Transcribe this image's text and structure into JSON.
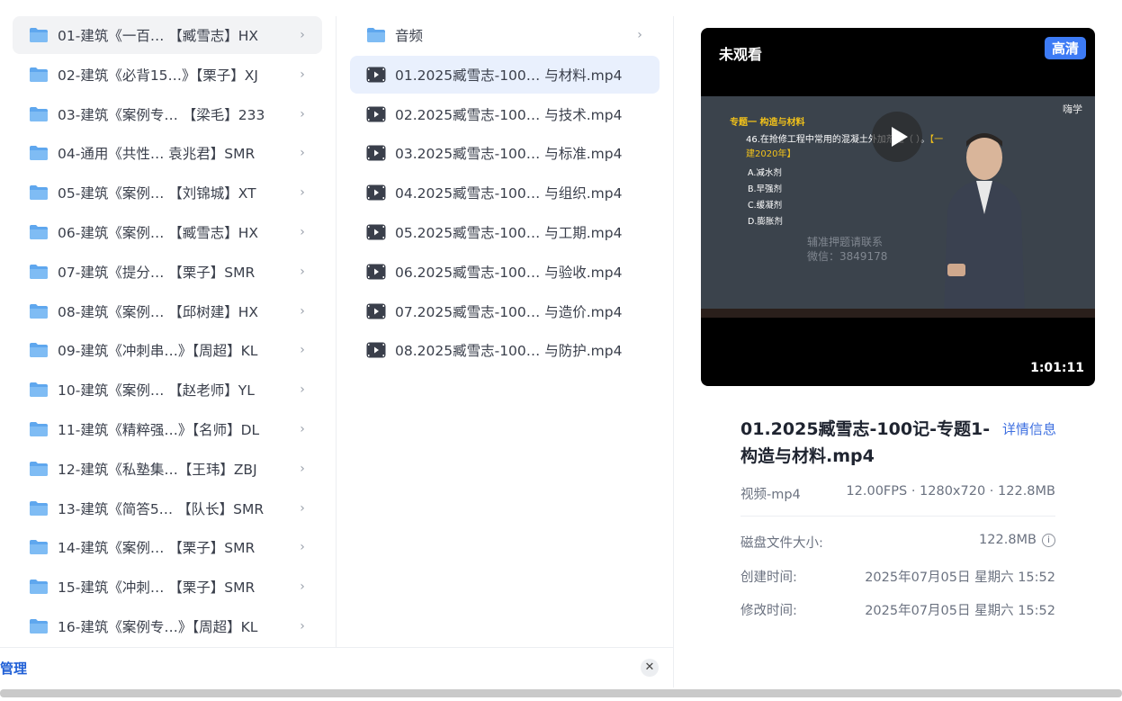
{
  "folders": [
    {
      "label": "01-建筑《一百…  【臧雪志】HX"
    },
    {
      "label": "02-建筑《必背15…》【栗子】XJ"
    },
    {
      "label": "03-建筑《案例专…  【梁毛】233"
    },
    {
      "label": "04-通用《共性…   袁兆君】SMR"
    },
    {
      "label": "05-建筑《案例…   【刘锦城】XT"
    },
    {
      "label": "06-建筑《案例…   【臧雪志】HX"
    },
    {
      "label": "07-建筑《提分…   【栗子】SMR"
    },
    {
      "label": "08-建筑《案例…   【邱树建】HX"
    },
    {
      "label": "09-建筑《冲刺串…》【周超】KL"
    },
    {
      "label": "10-建筑《案例…   【赵老师】YL"
    },
    {
      "label": "11-建筑《精粹强…》【名师】DL"
    },
    {
      "label": "12-建筑《私塾集…【王玮】ZBJ"
    },
    {
      "label": "13-建筑《简答5…  【队长】SMR"
    },
    {
      "label": "14-建筑《案例…   【栗子】SMR"
    },
    {
      "label": "15-建筑《冲刺…   【栗子】SMR"
    },
    {
      "label": "16-建筑《案例专…》【周超】KL"
    }
  ],
  "files": [
    {
      "label": "音频",
      "type": "folder"
    },
    {
      "label": "01.2025臧雪志-100…  与材料.mp4",
      "type": "video"
    },
    {
      "label": "02.2025臧雪志-100…  与技术.mp4",
      "type": "video"
    },
    {
      "label": "03.2025臧雪志-100…  与标准.mp4",
      "type": "video"
    },
    {
      "label": "04.2025臧雪志-100…  与组织.mp4",
      "type": "video"
    },
    {
      "label": "05.2025臧雪志-100…  与工期.mp4",
      "type": "video"
    },
    {
      "label": "06.2025臧雪志-100…  与验收.mp4",
      "type": "video"
    },
    {
      "label": "07.2025臧雪志-100…  与造价.mp4",
      "type": "video"
    },
    {
      "label": "08.2025臧雪志-100…  与防护.mp4",
      "type": "video"
    }
  ],
  "bottom": {
    "manage": "管理",
    "close_icon": "close-icon"
  },
  "preview": {
    "badge": "未观看",
    "quality": "高清",
    "duration": "1:01:11",
    "slide": {
      "title": "专题一 构造与材料",
      "logo": "嗨学",
      "question": "46.在抢修工程中常用的混凝土外加剂是（   ）。",
      "question_tag_a": "【一",
      "question_tag_b": "建2020年】",
      "options": [
        "A.减水剂",
        "B.早强剂",
        "C.缓凝剂",
        "D.膨胀剂"
      ],
      "watermark_1": "辅准押题请联系",
      "watermark_2": "微信：3849178"
    },
    "file_title": "01.2025臧雪志-100记-专题1-构造与材料.mp4",
    "detail_link": "详情信息",
    "meta_type": "视频-mp4",
    "meta_specs": "12.00FPS  ·  1280x720  ·  122.8MB",
    "disk_size_label": "磁盘文件大小:",
    "disk_size_value": "122.8MB",
    "created_label": "创建时间:",
    "created_value": "2025年07月05日 星期六 15:52",
    "modified_label": "修改时间:",
    "modified_value": "2025年07月05日 星期六 15:52"
  }
}
